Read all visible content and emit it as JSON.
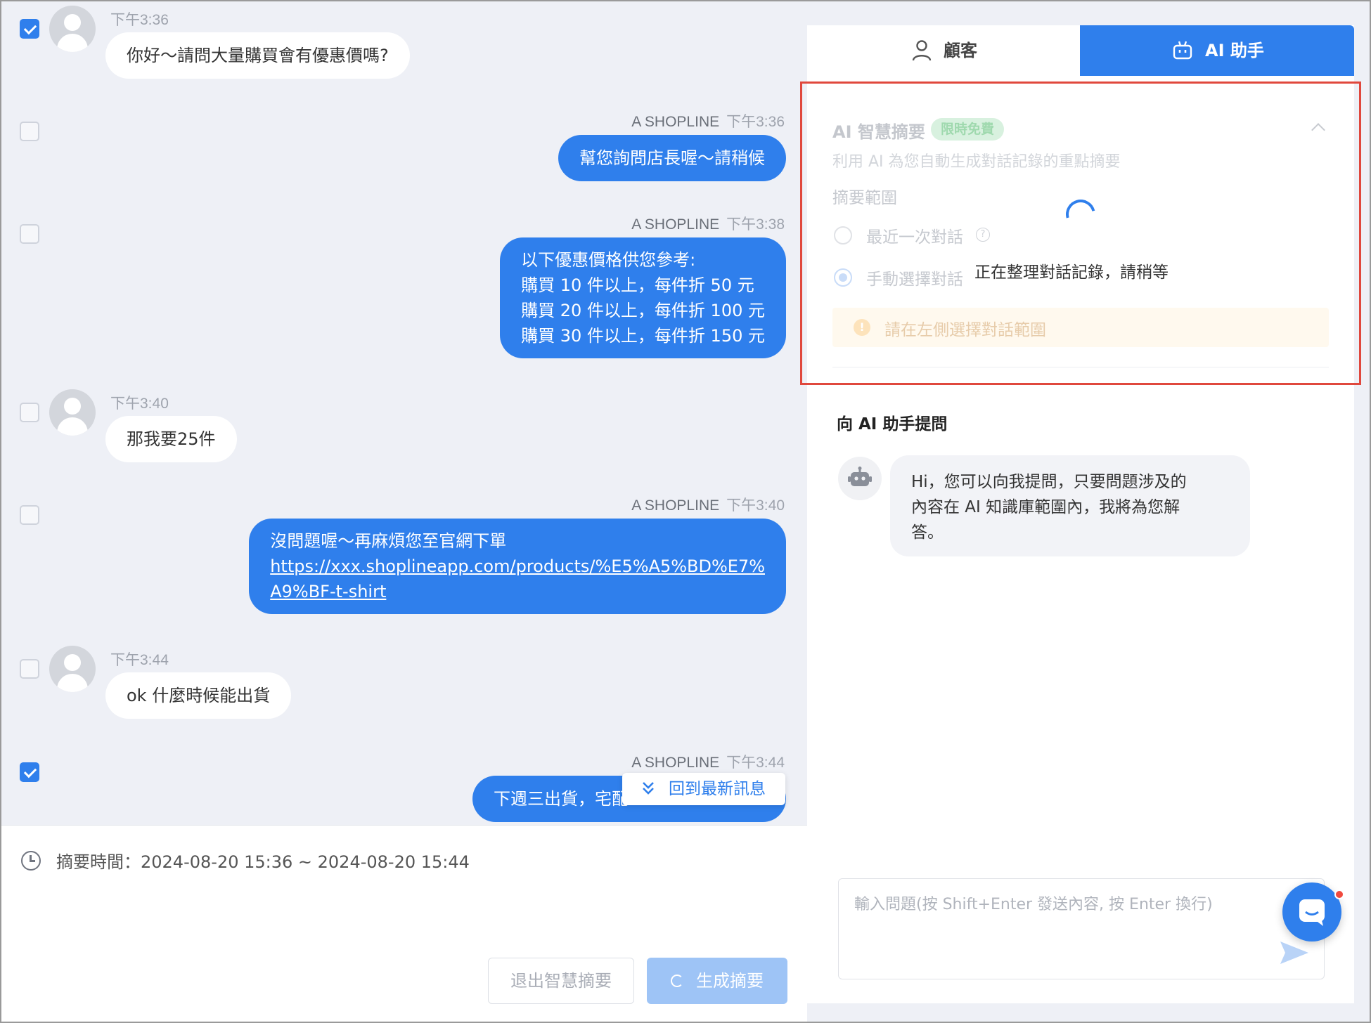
{
  "messages": [
    {
      "time": "下午3:36",
      "text": "你好～請問大量購買會有優惠價嗎?"
    },
    {
      "agent": "A SHOPLINE",
      "time": "下午3:36",
      "text": "幫您詢問店長喔～請稍候"
    },
    {
      "agent": "A SHOPLINE",
      "time": "下午3:38",
      "lines": [
        "以下優惠價格供您參考:",
        "購買 10 件以上，每件折 50 元",
        "購買 20 件以上，每件折 100 元",
        "購買 30 件以上，每件折 150 元"
      ]
    },
    {
      "time": "下午3:40",
      "text": "那我要25件"
    },
    {
      "agent": "A SHOPLINE",
      "time": "下午3:40",
      "text": "沒問題喔～再麻煩您至官網下單",
      "link_line1": "https://xxx.shoplineapp.com/products/%E5%A5%BD%E7%",
      "link_line2": "A9%BF-t-shirt"
    },
    {
      "time": "下午3:44",
      "text": "ok 什麼時候能出貨"
    },
    {
      "agent": "A SHOPLINE",
      "time": "下午3:44",
      "text": "下週三出貨，宅配"
    }
  ],
  "checkboxes": [
    true,
    false,
    false,
    false,
    false,
    false,
    true
  ],
  "jump_latest": {
    "label": "回到最新訊息",
    "icon": "double-chevron-down-icon"
  },
  "footer": {
    "range_label": "摘要時間：",
    "range_value": "2024-08-20 15:36 ~ 2024-08-20 15:44",
    "exit_button": "退出智慧摘要",
    "generate_button": "生成摘要"
  },
  "tabs": {
    "customer": "顧客",
    "ai": "AI 助手"
  },
  "summary": {
    "title": "AI 智慧摘要",
    "badge": "限時免費",
    "description": "利用 AI 為您自動生成對話記錄的重點摘要",
    "range_heading": "摘要範圍",
    "option_recent": "最近一次對話",
    "option_manual": "手動選擇對話",
    "selected_option": "手動選擇對話",
    "warning": "請在左側選擇對話範圍",
    "loading": "正在整理對話記錄，請稍等"
  },
  "assistant": {
    "title": "向 AI 助手提問",
    "greeting_lines": [
      "Hi，您可以向我提問，只要問題涉及的",
      "內容在 AI 知識庫範圍內，我將為您解",
      "答。"
    ],
    "input_placeholder": "輸入問題(按 Shift+Enter 發送內容, 按 Enter 換行)"
  },
  "colors": {
    "primary": "#2f7fec",
    "highlight_box": "#e0483d",
    "chat_bg": "#eef0f6"
  }
}
